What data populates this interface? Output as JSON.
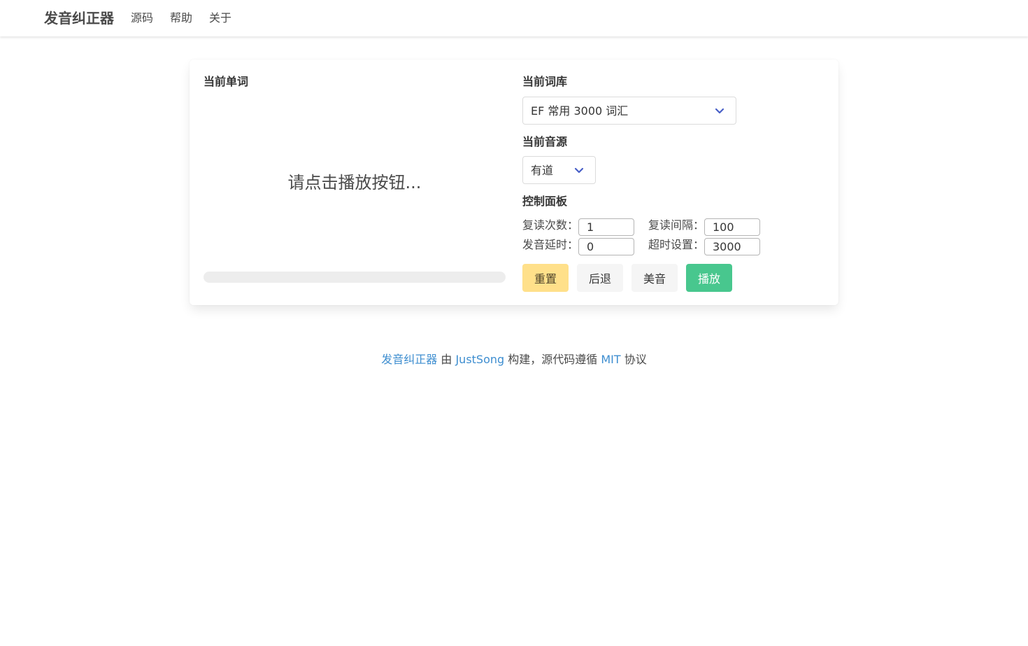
{
  "navbar": {
    "brand": "发音纠正器",
    "links": [
      "源码",
      "帮助",
      "关于"
    ]
  },
  "word_panel": {
    "title": "当前单词",
    "display_text": "请点击播放按钮...",
    "progress": 0
  },
  "dictionary": {
    "title": "当前词库",
    "selected": "EF 常用 3000 词汇"
  },
  "audio_source": {
    "title": "当前音源",
    "selected": "有道"
  },
  "control_panel": {
    "title": "控制面板",
    "repeat_count_label": "复读次数：",
    "repeat_count_value": "1",
    "repeat_interval_label": "复读间隔：",
    "repeat_interval_value": "100",
    "pronounce_delay_label": "发音延时：",
    "pronounce_delay_value": "0",
    "timeout_label": "超时设置：",
    "timeout_value": "3000"
  },
  "buttons": {
    "reset": "重置",
    "back": "后退",
    "accent": "美音",
    "play": "播放"
  },
  "footer": {
    "app_link": "发音纠正器",
    "by": " 由 ",
    "author_link": "JustSong",
    "built_text": " 构建，源代码遵循 ",
    "license_link": "MIT",
    "license_suffix": " 协议"
  },
  "colors": {
    "warning": "#ffe08a",
    "success": "#48c78e",
    "link": "#3e8ed0",
    "chevron": "#485fc7"
  }
}
